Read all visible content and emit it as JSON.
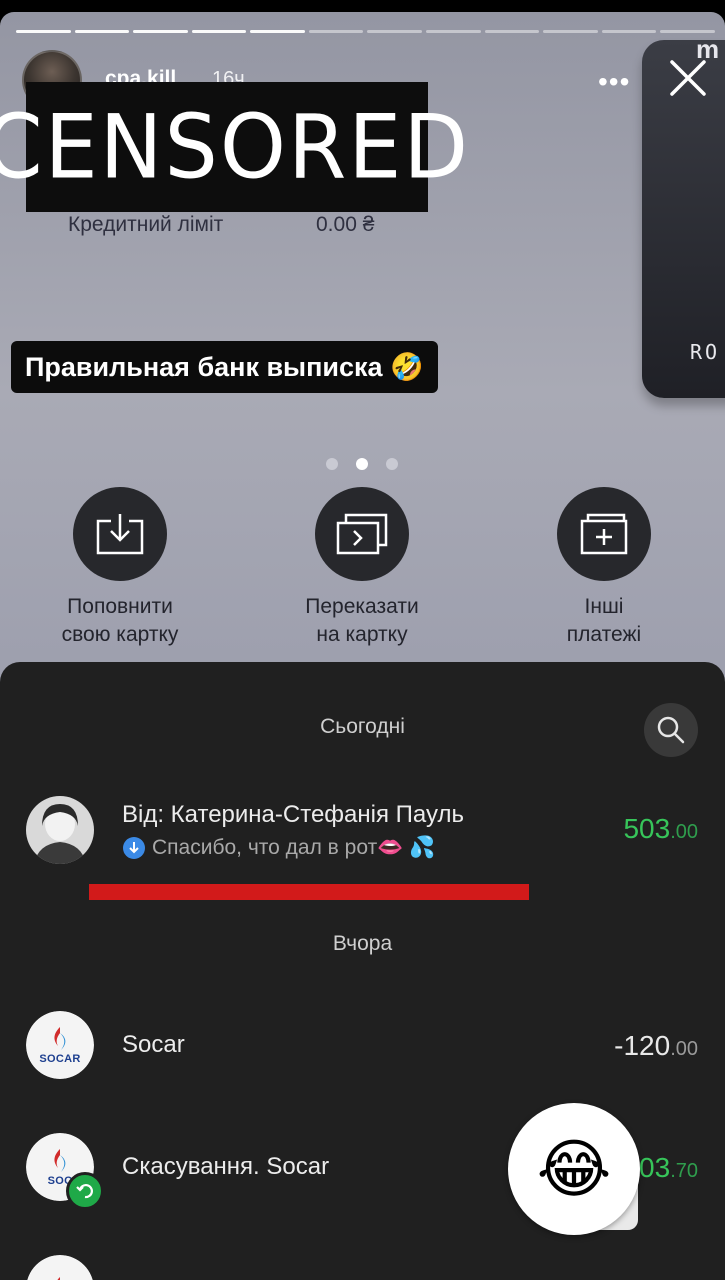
{
  "story": {
    "username": "cpa.kill",
    "time_ago": "16ч.",
    "segments": [
      true,
      true,
      true,
      true,
      true,
      false,
      false,
      false,
      false,
      false,
      false,
      false,
      false
    ]
  },
  "overlays": {
    "censored_text": "CENSORED",
    "caption": "Правильная банк выписка 🤣"
  },
  "card": {
    "credit_limit_label": "Кредитний ліміт",
    "credit_limit_value": "0.00 ₴",
    "side_card_label": "RO",
    "side_card_corner": "m",
    "pager_active_index": 1
  },
  "actions": [
    {
      "line1": "Поповнити",
      "line2": "свою картку",
      "icon": "download-icon"
    },
    {
      "line1": "Переказати",
      "line2": "на картку",
      "icon": "transfer-card-icon"
    },
    {
      "line1": "Інші",
      "line2": "платежі",
      "icon": "add-payment-icon"
    }
  ],
  "transactions": {
    "today_label": "Сьогодні",
    "yesterday_label": "Вчора",
    "items": [
      {
        "title": "Від: Катерина-Стефанія Пауль",
        "comment": "Спасибо, что дал в рот👄 💦",
        "amount_int": "503",
        "amount_dec": ".00",
        "positive": true
      },
      {
        "title": "Socar",
        "amount_int": "-120",
        "amount_dec": ".00",
        "positive": false,
        "logo_text": "SOCAR"
      },
      {
        "title": "Скасування. Socar",
        "amount_int": "03",
        "amount_dec": ".70",
        "positive": true,
        "logo_text": "SOC"
      }
    ]
  },
  "reaction_emoji": "😂",
  "colors": {
    "sheet_bg": "#202020",
    "positive": "#37c55a",
    "redline": "#d21a1a"
  }
}
